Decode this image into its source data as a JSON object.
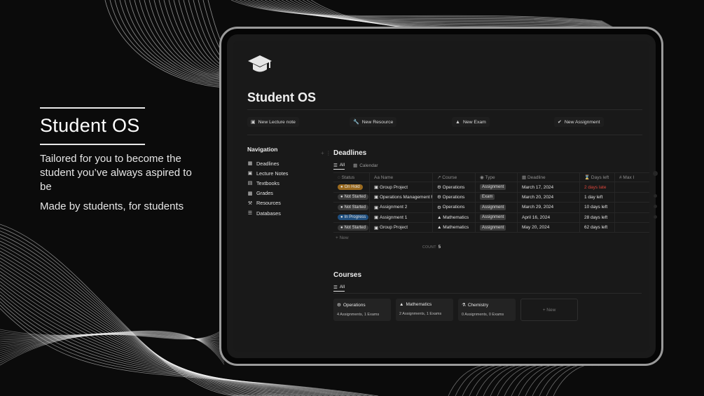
{
  "promo": {
    "title": "Student OS",
    "tagline": "Tailored for you to become the student you’ve always aspired to be",
    "byline": "Made by students, for students"
  },
  "page": {
    "title": "Student OS",
    "buttons": [
      {
        "label": "New Lecture note",
        "icon": "note-icon"
      },
      {
        "label": "New Resource",
        "icon": "wrench-icon"
      },
      {
        "label": "New Exam",
        "icon": "graduation-cap-icon"
      },
      {
        "label": "New Assignment",
        "icon": "check-circle-icon"
      }
    ]
  },
  "navigation": {
    "title": "Navigation",
    "items": [
      "Deadlines",
      "Lecture Notes",
      "Textbooks",
      "Grades",
      "Resources",
      "Databases"
    ]
  },
  "deadlines": {
    "title": "Deadlines",
    "views": [
      "All",
      "Calendar"
    ],
    "columns": [
      "Status",
      "Name",
      "Course",
      "Type",
      "Deadline",
      "Days left",
      "Max I"
    ],
    "rows": [
      {
        "status": "On Hold",
        "status_color": "#9a6a1f",
        "name": "Group Project",
        "course": "Operations",
        "type": "Assignment",
        "deadline": "March 17, 2024",
        "days_left": "2 days late",
        "late": true
      },
      {
        "status": "Not Started",
        "status_color": "#3a3a3a",
        "name": "Operations Management F",
        "course": "Operations",
        "type": "Exam",
        "deadline": "March 20, 2024",
        "days_left": "1 day left",
        "late": false
      },
      {
        "status": "Not Started",
        "status_color": "#3a3a3a",
        "name": "Assignment 2",
        "course": "Operations",
        "type": "Assignment",
        "deadline": "March 29, 2024",
        "days_left": "10 days left",
        "late": false
      },
      {
        "status": "In Progress",
        "status_color": "#1f4f7f",
        "name": "Assignment 1",
        "course": "Mathematics",
        "type": "Assignment",
        "deadline": "April 16, 2024",
        "days_left": "28 days left",
        "late": false
      },
      {
        "status": "Not Started",
        "status_color": "#3a3a3a",
        "name": "Group Project",
        "course": "Mathematics",
        "type": "Assignment",
        "deadline": "May 20, 2024",
        "days_left": "62 days left",
        "late": false
      }
    ],
    "new_label": "+ New",
    "count_label": "COUNT",
    "count_value": "5"
  },
  "courses": {
    "title": "Courses",
    "views": [
      "All"
    ],
    "cards": [
      {
        "name": "Operations",
        "stats": "4 Assignments, 1 Exams",
        "icon": "gear-icon"
      },
      {
        "name": "Mathematics",
        "stats": "2 Assignments, 1 Exams",
        "icon": "graduation-cap-icon"
      },
      {
        "name": "Chemistry",
        "stats": "0 Assignments, 0 Exams",
        "icon": "flask-icon"
      }
    ],
    "new_label": "+ New"
  },
  "colors": {
    "late": "#e0463c",
    "background": "#0b0b0b",
    "page": "#191919"
  }
}
